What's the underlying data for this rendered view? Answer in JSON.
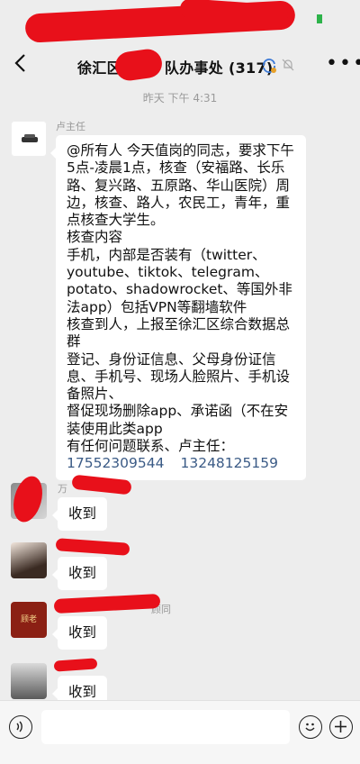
{
  "header": {
    "title_prefix": "徐汇区",
    "title_suffix": "队办事处 (317)",
    "back_icon": "chevron-left-icon",
    "more_icon": "ellipsis-icon"
  },
  "timestamp": "昨天 下午 4:31",
  "messages": [
    {
      "sender": "卢主任",
      "paragraphs": [
        "@所有人 今天值岗的同志，要求下午5点-凌晨1点，核查（安福路、长乐路、复兴路、五原路、华山医院）周边，核查、路人，农民工，青年，重点核查大学生。",
        "核查内容",
        "手机，内部是否装有（twitter、youtube、tiktok、telegram、potato、shadowrocket、等国外非法app）包括VPN等翻墙软件",
        "核查到人，上报至徐汇区综合数据总群",
        "登记、身份证信息、父母身份证信息、手机号、现场人脸照片、手机设备照片、",
        "督促现场删除app、承诺函（不在安装使用此类app",
        "有任何问题联系、卢主任："
      ],
      "phones": [
        "17552309544",
        "13248125159"
      ]
    },
    {
      "sender": "万",
      "text": "收到"
    },
    {
      "sender": "",
      "text": "收到"
    },
    {
      "sender": "",
      "sender_tail": "顾同",
      "avatar_text": "顾老",
      "text": "收到"
    },
    {
      "sender": "",
      "text": "收到"
    }
  ],
  "colors": {
    "background": "#ededed",
    "bubble": "#ffffff",
    "link": "#3b5b86",
    "redaction": "#e8101a"
  }
}
